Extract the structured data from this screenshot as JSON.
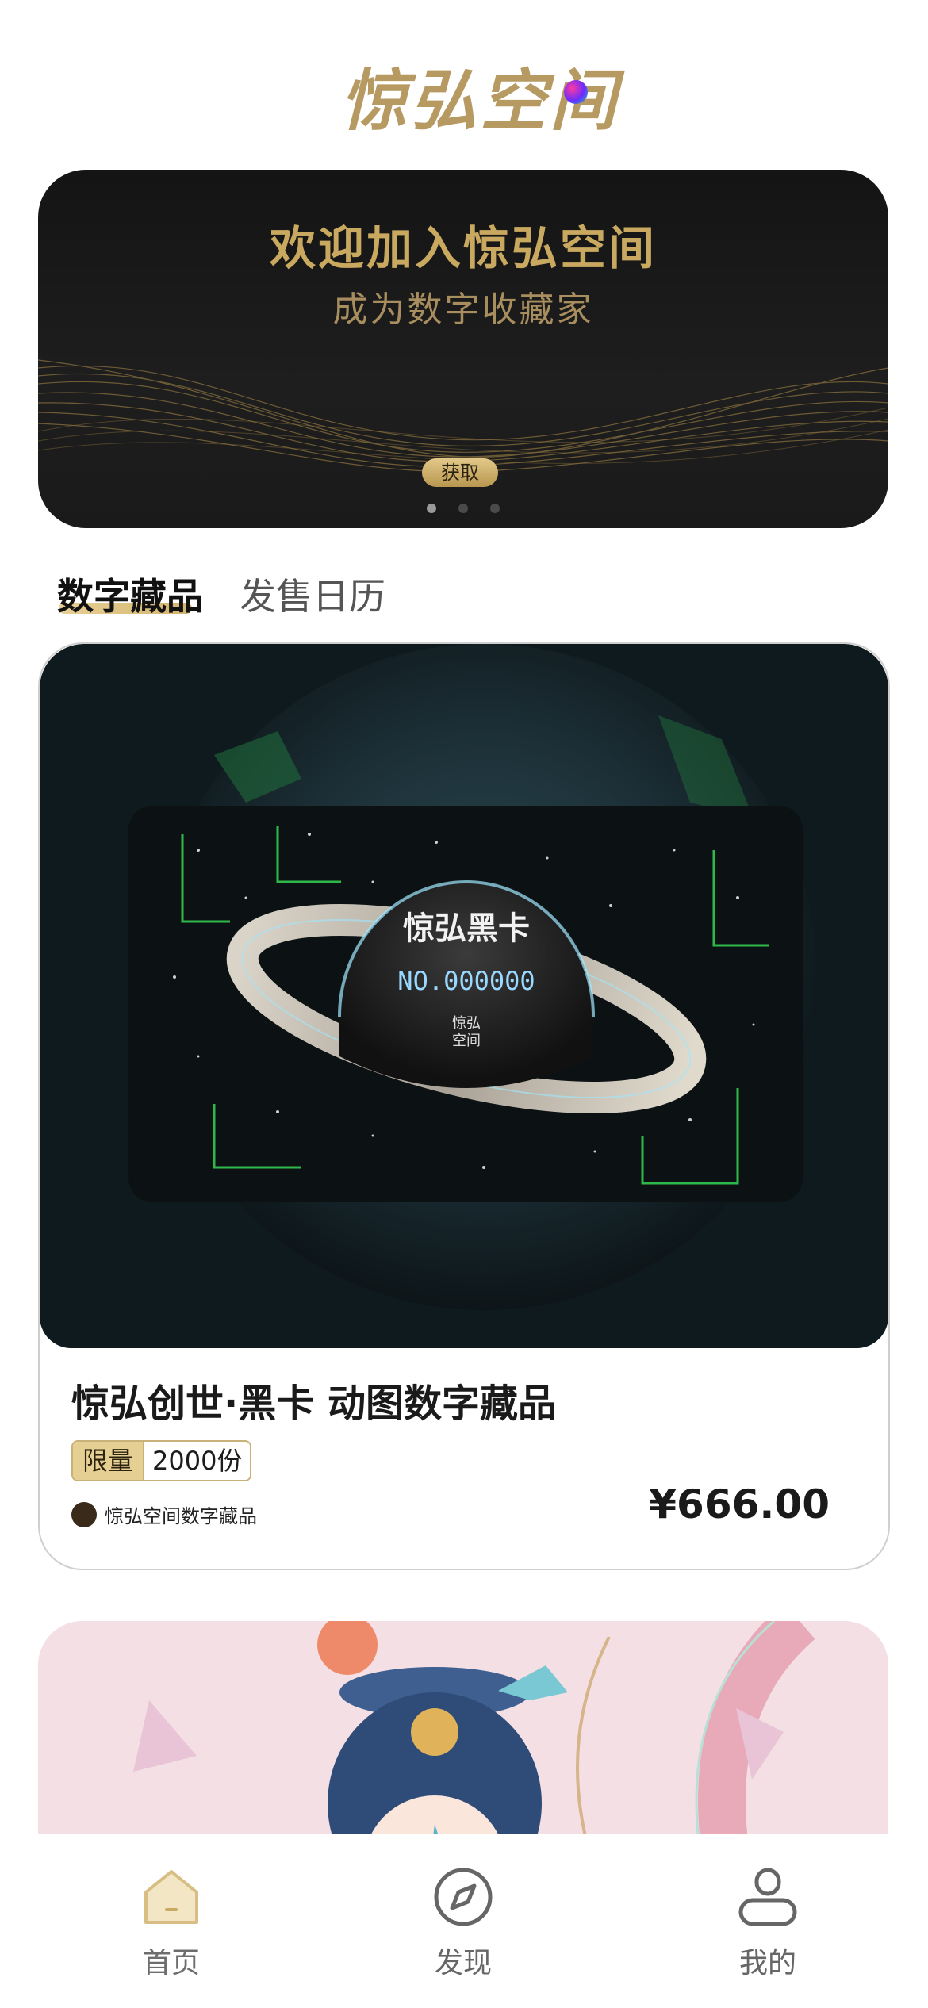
{
  "app": {
    "logo_text": "惊弘空间"
  },
  "banner": {
    "title": "欢迎加入惊弘空间",
    "subtitle": "成为数字收藏家",
    "button_label": "获取",
    "page_count": 3,
    "active_page": 1
  },
  "tabs": [
    {
      "label": "数字藏品",
      "active": true
    },
    {
      "label": "发售日历",
      "active": false
    }
  ],
  "products": [
    {
      "title": "惊弘创世·黑卡 动图数字藏品",
      "limit_label": "限量",
      "limit_value": "2000份",
      "publisher": "惊弘空间数字藏品",
      "price": "¥666.00",
      "image": {
        "card_title": "惊弘黑卡",
        "card_number": "NO.000000",
        "card_brand": "惊弘\n空间"
      }
    }
  ],
  "bottom_nav": [
    {
      "label": "首页",
      "icon": "home-icon",
      "active": true
    },
    {
      "label": "发现",
      "icon": "compass-icon",
      "active": false
    },
    {
      "label": "我的",
      "icon": "profile-icon",
      "active": false
    }
  ],
  "colors": {
    "accent_gold": "#c9a85f",
    "banner_bg": "#1a1a1a",
    "tab_highlight": "#e2c889"
  }
}
